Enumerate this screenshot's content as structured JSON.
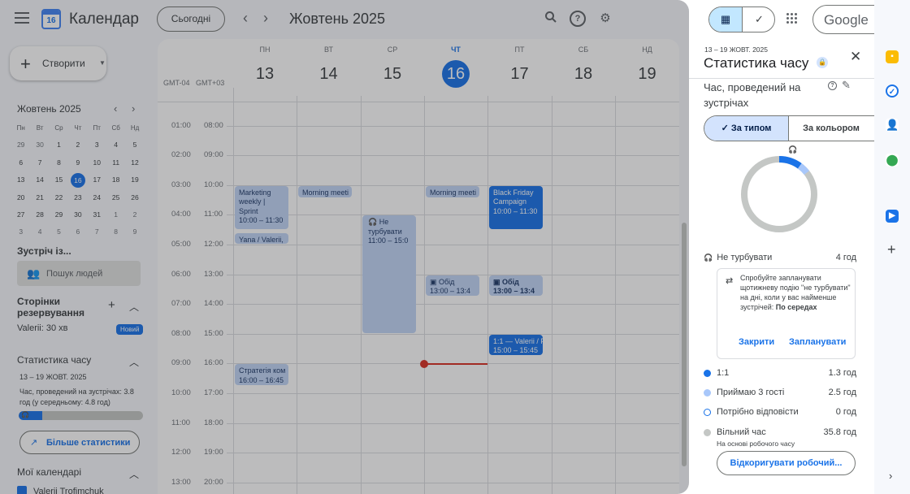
{
  "header": {
    "app_title": "Календар",
    "logo_day": "16",
    "today_label": "Сьогодні",
    "prev": "‹",
    "next": "›",
    "month_title": "Жовтень 2025"
  },
  "sidebar": {
    "create_label": "Створити",
    "mini_title": "Жовтень 2025",
    "weekdays": [
      "Пн",
      "Вт",
      "Ср",
      "Чт",
      "Пт",
      "Сб",
      "Нд"
    ],
    "days": [
      [
        "29",
        "30",
        "1",
        "2",
        "3",
        "4",
        "5"
      ],
      [
        "6",
        "7",
        "8",
        "9",
        "10",
        "11",
        "12"
      ],
      [
        "13",
        "14",
        "15",
        "16",
        "17",
        "18",
        "19"
      ],
      [
        "20",
        "21",
        "22",
        "23",
        "24",
        "25",
        "26"
      ],
      [
        "27",
        "28",
        "29",
        "30",
        "31",
        "1",
        "2"
      ],
      [
        "3",
        "4",
        "5",
        "6",
        "7",
        "8",
        "9"
      ]
    ],
    "meet_with": "Зустріч із...",
    "search_people": "Пошук людей",
    "booking_title": "Сторінки резервування",
    "booking_item": "Valerii: 30 хв",
    "new_badge": "Новий",
    "stats_title": "Статистика часу",
    "stats_date": "13 – 19 ЖОВТ. 2025",
    "stats_desc": "Час, проведений на зустрічах: 3.8 год (у середньому: 4.8 год)",
    "stats_progress": 0.19,
    "more_stats": "Більше статистики",
    "my_calendars": "Мої календарі",
    "my_calendar_item": "Valerii Trofimchuk"
  },
  "calendar": {
    "tz1": "GMT-04",
    "tz2": "GMT+03",
    "days": [
      {
        "name": "ПН",
        "num": "13"
      },
      {
        "name": "ВТ",
        "num": "14"
      },
      {
        "name": "СР",
        "num": "15"
      },
      {
        "name": "ЧТ",
        "num": "16"
      },
      {
        "name": "ПТ",
        "num": "17"
      },
      {
        "name": "СБ",
        "num": "18"
      },
      {
        "name": "НД",
        "num": "19"
      }
    ],
    "times1": [
      "01:00",
      "02:00",
      "03:00",
      "04:00",
      "05:00",
      "06:00",
      "07:00",
      "08:00",
      "09:00",
      "10:00",
      "11:00",
      "12:00",
      "13:00"
    ],
    "times2": [
      "08:00",
      "09:00",
      "10:00",
      "11:00",
      "12:00",
      "13:00",
      "14:00",
      "15:00",
      "16:00",
      "17:00",
      "18:00",
      "19:00",
      "20:00"
    ],
    "events": {
      "marketing_title": "Marketing weekly | Sprint",
      "marketing_time": "10:00 – 11:30",
      "yana": "Yana / Valerii,",
      "strategy_title": "Стратегія ком",
      "strategy_time": "16:00 – 16:45",
      "morning_tue": "Morning meeti",
      "dnd_title": "Не турбувати",
      "dnd_time": "11:00 – 15:0",
      "morning_thu": "Morning meeti",
      "lunch_thu_title": "Обід",
      "lunch_thu_time": "13:00 – 13:4",
      "bf_title": "Black Friday Campaign",
      "bf_time": "10:00 – 11:30",
      "lunch_fri_title": "Обід",
      "lunch_fri_time": "13:00 – 13:4",
      "oneone_title": "1:1 — Valerii / F",
      "oneone_time": "15:00 – 15:45"
    }
  },
  "panel": {
    "date": "13 – 19 ЖОВТ. 2025",
    "title": "Статистика часу",
    "subtitle": "Час, проведений на зустрічах",
    "tab_type": "За типом",
    "tab_color": "За кольором",
    "dnd_label": "Не турбувати",
    "dnd_value": "4 год",
    "suggestion_text": "Спробуйте запланувати щотижневу подію \"не турбувати\" на дні, коли у вас найменше зустрічей: ",
    "suggestion_day": "По середах",
    "close_link": "Закрити",
    "plan_link": "Запланувати",
    "legend": [
      {
        "name": "1:1",
        "value": "1.3 год",
        "color": "#1a73e8"
      },
      {
        "name": "Приймаю 3 гості",
        "value": "2.5 год",
        "color": "#a8c7fa"
      },
      {
        "name": "Потрібно відповісти",
        "value": "0 год",
        "color": "#ffffff"
      },
      {
        "name": "Вільний час",
        "value": "35.8 год",
        "color": "#c4c7c5"
      }
    ],
    "free_sub": "На основі робочого часу",
    "adjust_btn": "Відкоригувати робочий..."
  },
  "top_right": {
    "google": "Google"
  }
}
